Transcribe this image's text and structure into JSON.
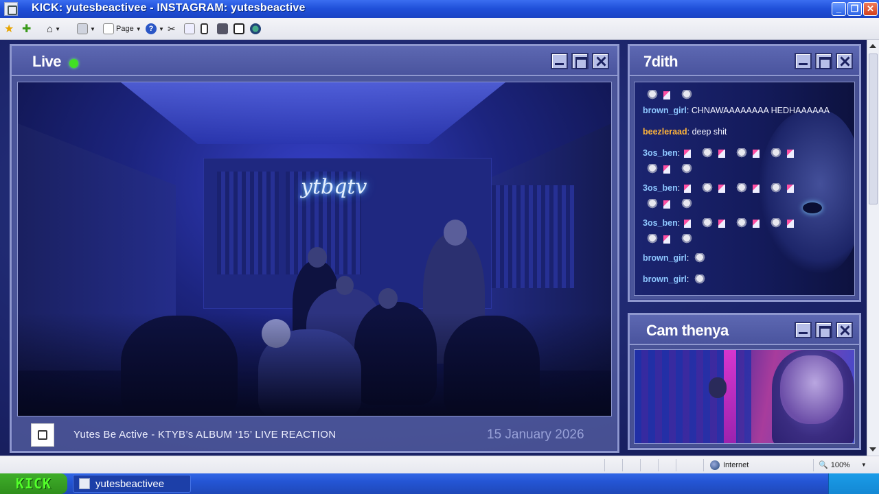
{
  "window": {
    "title": "KICK: yutesbeactivee -  INSTAGRAM: yutesbeactive"
  },
  "toolbar": {
    "page_label": "Page"
  },
  "live_panel": {
    "title": "Live",
    "stream_title": "Yutes Be Active - KTYB’s ALBUM ‘15’ LIVE REACTION",
    "date": "15 January 2026",
    "neon_sign": "ytbqtv"
  },
  "chat_panel": {
    "title": "7dith",
    "messages": [
      {
        "user": "brown_girl",
        "user_color": "#8ec7ff",
        "text": "CHNAWAAAAAAAA HEDHAAAAAA"
      },
      {
        "user": "beezleraad",
        "user_color": "#ffb43a",
        "text": "deep shit"
      },
      {
        "user": "3os_ben",
        "user_color": "#8ec7ff",
        "text": ""
      },
      {
        "user": "3os_ben",
        "user_color": "#8ec7ff",
        "text": ""
      },
      {
        "user": "3os_ben",
        "user_color": "#8ec7ff",
        "text": ""
      },
      {
        "user": "brown_girl",
        "user_color": "#8ec7ff",
        "text": ""
      },
      {
        "user": "brown_girl",
        "user_color": "#8ec7ff",
        "text": ""
      }
    ],
    "colon": ":"
  },
  "cam_panel": {
    "title": "Cam thenya"
  },
  "statusbar": {
    "zone": "Internet",
    "zoom": "100%"
  },
  "taskbar": {
    "start_label": "KICK",
    "task_label": "yutesbeactivee"
  },
  "colors": {
    "live_dot": "#41e023",
    "panel_frame": "#8f98cf",
    "kick_green": "#53ff2a"
  }
}
